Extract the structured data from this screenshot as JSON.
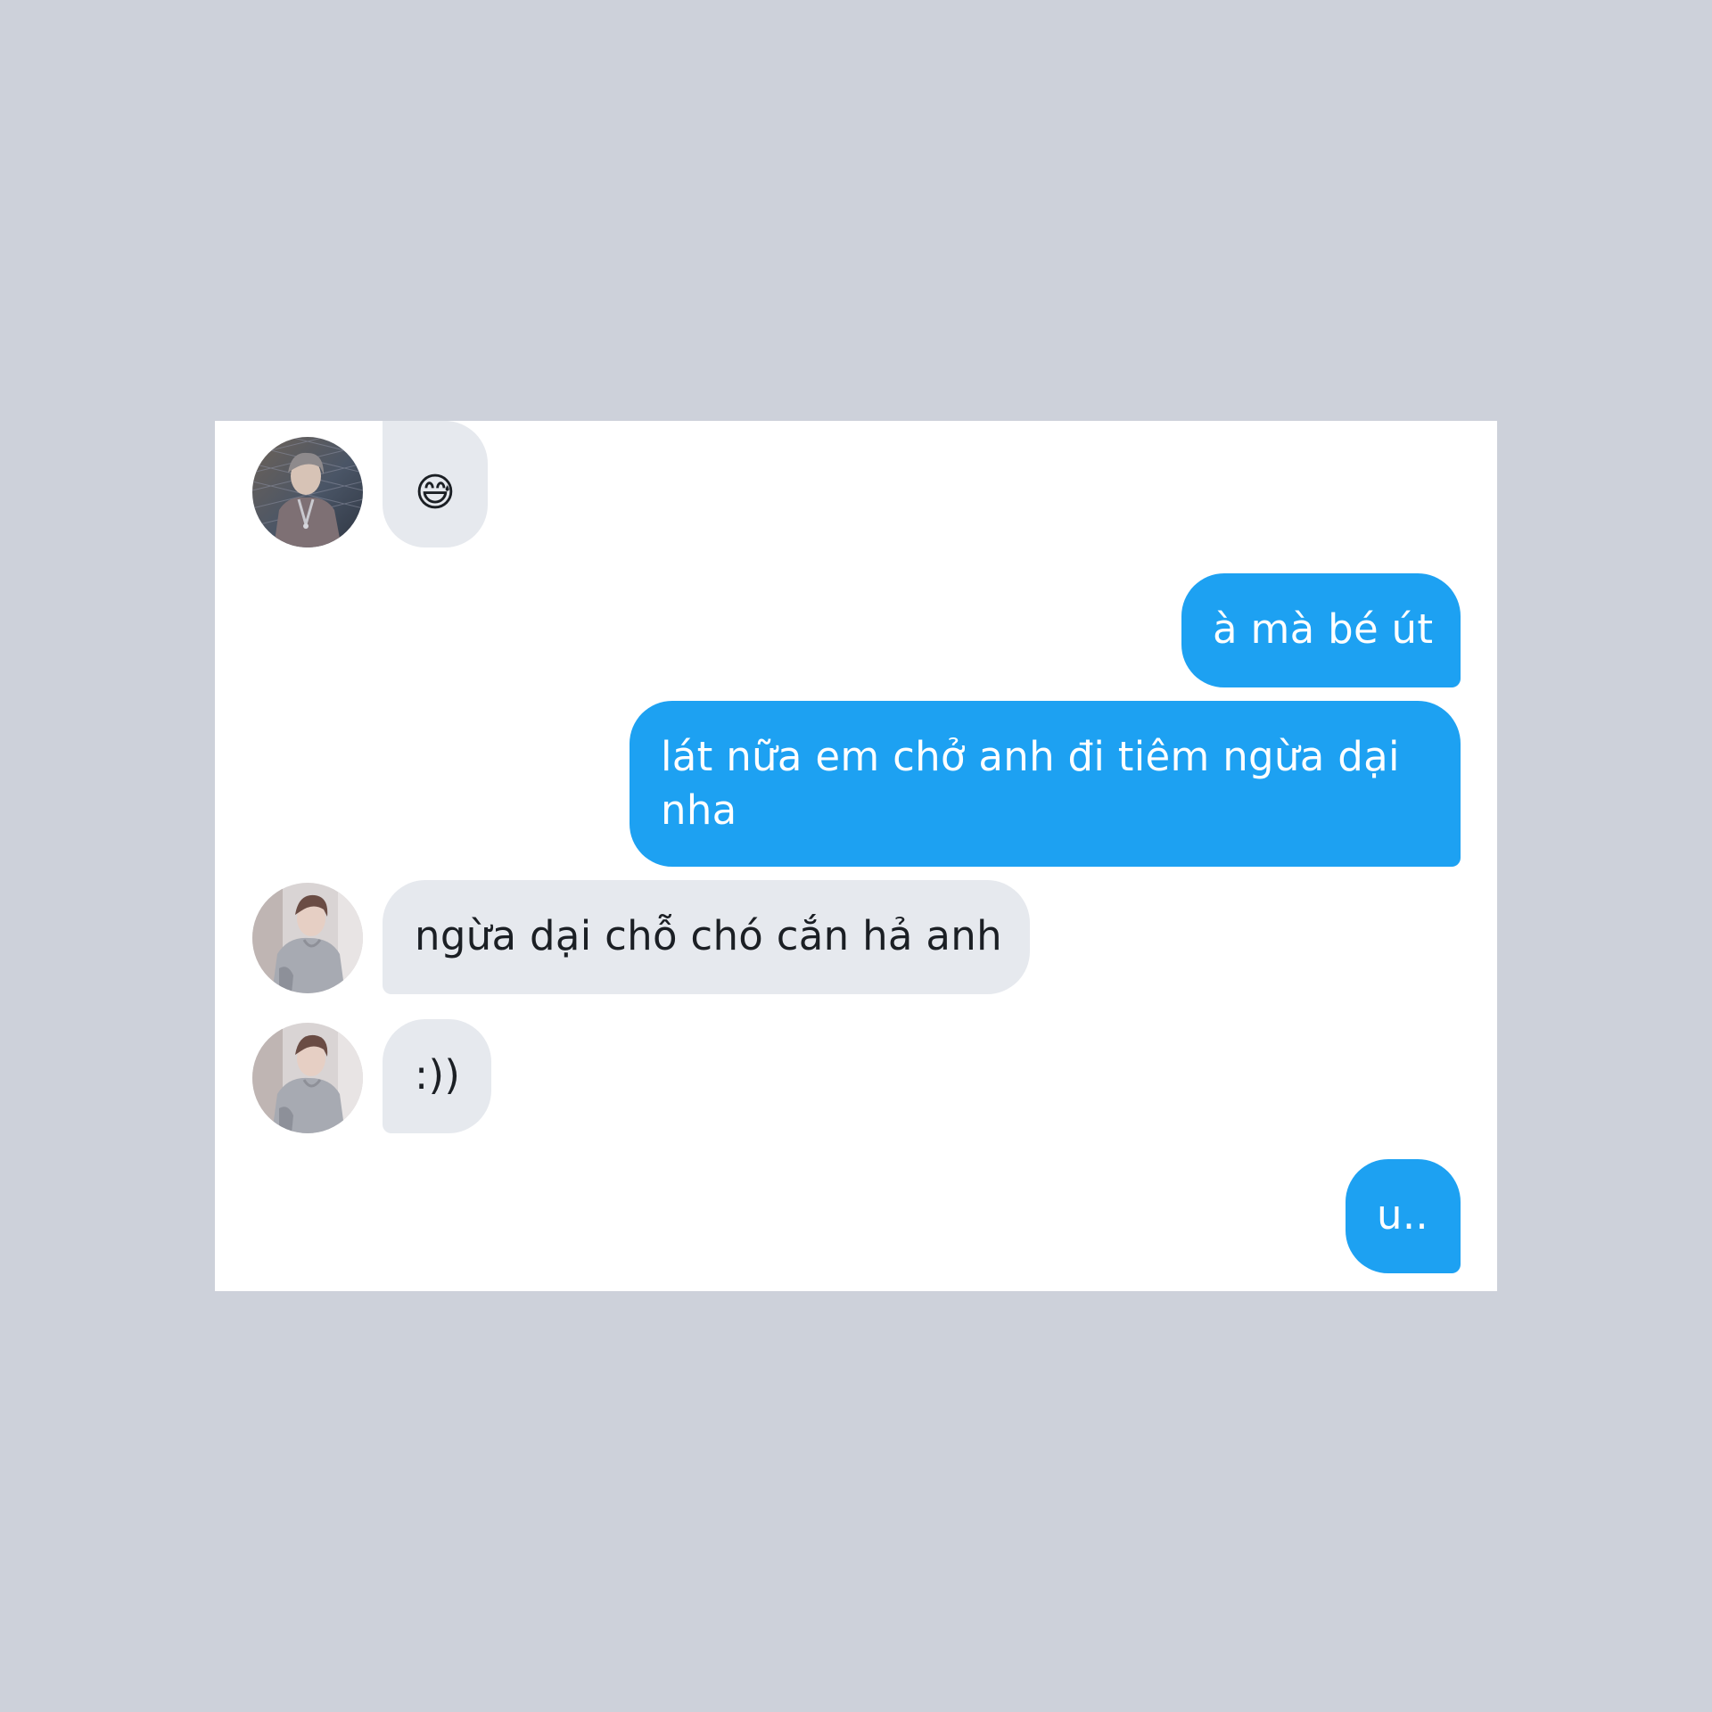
{
  "colors": {
    "page_background": "#cdd1da",
    "card_background": "#ffffff",
    "incoming_bubble": "#e6e9ee",
    "outgoing_bubble": "#1da1f2",
    "outgoing_text": "#ffffff",
    "incoming_text": "#1b1f24"
  },
  "messages": [
    {
      "direction": "incoming",
      "avatar": "avatar-photo",
      "icon": "sweat-smile-emoji-icon",
      "text": "😅"
    },
    {
      "direction": "outgoing",
      "text": "à mà bé út"
    },
    {
      "direction": "outgoing",
      "text": "lát nữa em chở anh đi tiêm ngừa dại nha"
    },
    {
      "direction": "incoming",
      "avatar": "avatar-photo",
      "text": "ngừa dại chỗ chó cắn hả anh"
    },
    {
      "direction": "incoming",
      "avatar": "avatar-photo",
      "text": ":))"
    },
    {
      "direction": "outgoing",
      "text": "u.."
    }
  ]
}
